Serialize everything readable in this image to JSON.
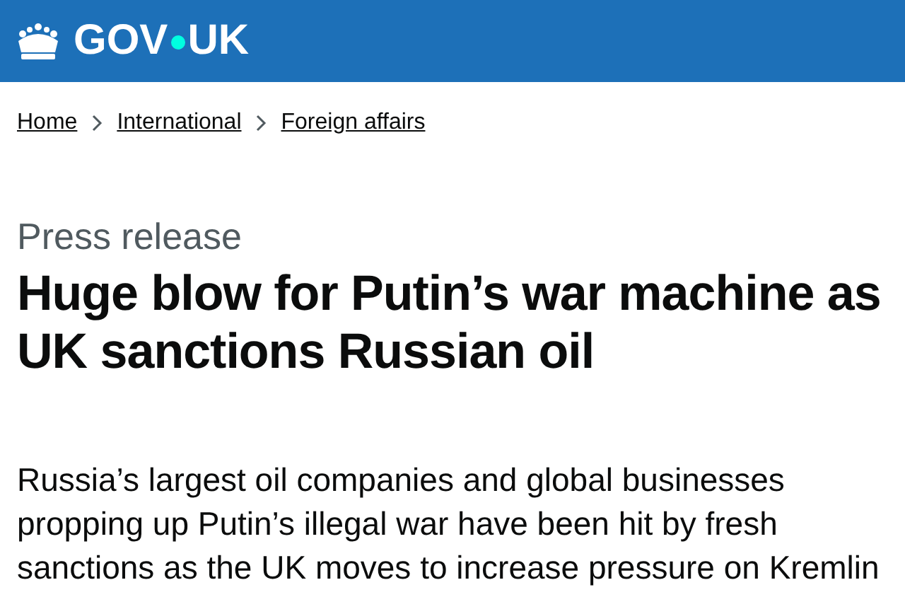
{
  "header": {
    "logo_text": "GOV",
    "logo_text_2": "UK"
  },
  "breadcrumbs": [
    {
      "label": "Home"
    },
    {
      "label": "International"
    },
    {
      "label": "Foreign affairs"
    }
  ],
  "document_type": "Press release",
  "title": "Huge blow for Putin’s war machine as UK sanctions Russian oil",
  "summary": "Russia’s largest oil companies and global businesses propping up Putin’s illegal war have been hit by fresh sanctions as the UK moves to increase pressure on Kremlin"
}
